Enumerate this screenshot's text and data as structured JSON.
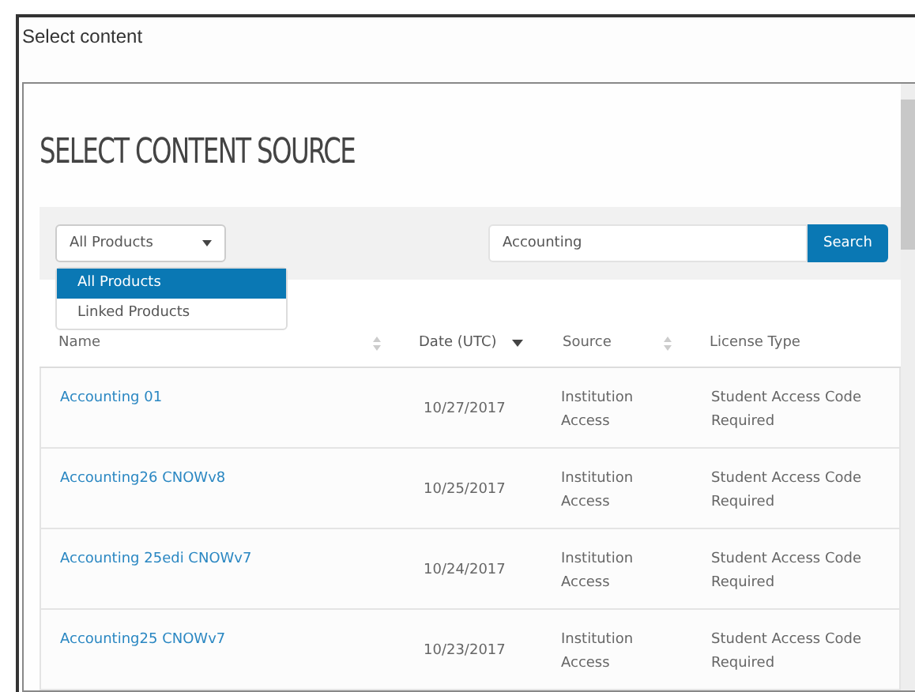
{
  "window": {
    "title": "Select content"
  },
  "heading": "SELECT CONTENT SOURCE",
  "filter": {
    "value": "All Products",
    "expanded": true,
    "options": [
      {
        "label": "All Products",
        "selected": true
      },
      {
        "label": "Linked Products",
        "selected": false
      }
    ]
  },
  "search": {
    "value": "Accounting",
    "button": "Search"
  },
  "table": {
    "columns": [
      {
        "label": "Name",
        "sortable": true,
        "sorted": false
      },
      {
        "label": "Date (UTC)",
        "sortable": true,
        "sorted": true
      },
      {
        "label": "Source",
        "sortable": true,
        "sorted": false
      },
      {
        "label": "License Type",
        "sortable": false,
        "sorted": false
      }
    ],
    "rows": [
      {
        "name": "Accounting  01",
        "date": "10/27/2017",
        "source": "Institution Access",
        "license": "Student Access Code Required"
      },
      {
        "name": "Accounting26  CNOWv8",
        "date": "10/25/2017",
        "source": "Institution Access",
        "license": "Student Access Code Required"
      },
      {
        "name": "Accounting 25edi CNOWv7",
        "date": "10/24/2017",
        "source": "Institution Access",
        "license": "Student Access Code Required"
      },
      {
        "name": "Accounting25  CNOWv7",
        "date": "10/23/2017",
        "source": "Institution Access",
        "license": "Student Access Code Required"
      }
    ]
  }
}
